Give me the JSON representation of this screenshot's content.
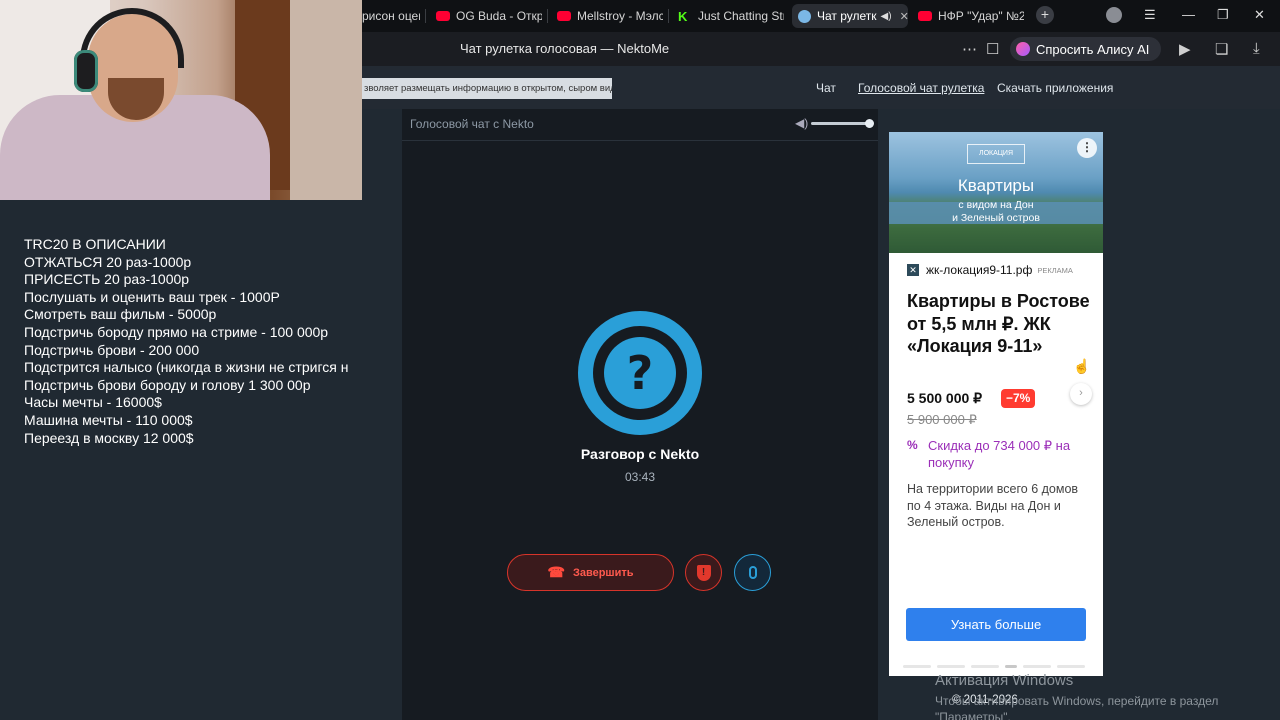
{
  "browser": {
    "tabs": [
      {
        "label": "рисон оцен",
        "icon": "none"
      },
      {
        "label": "OG Buda - Откр",
        "icon": "youtube"
      },
      {
        "label": "Mellstroy - Мэлс",
        "icon": "youtube"
      },
      {
        "label": "Just Chatting Str",
        "icon": "kick"
      },
      {
        "label": "Чат рулетк",
        "icon": "nekto",
        "active": true
      },
      {
        "label": "НФР \"Удар\" №2",
        "icon": "youtube"
      }
    ],
    "page_title": "Чат рулетка голосовая — NektoMe",
    "alice_button": "Спросить Алису AI",
    "close_tab_glyph": "✕",
    "new_tab_glyph": "+"
  },
  "site": {
    "notice": "зволяет размещать информацию в открытом, сыром виде!",
    "nav": [
      {
        "label": "Чат",
        "current": false
      },
      {
        "label": "Голосовой чат рулетка",
        "current": true
      },
      {
        "label": "Скачать приложения",
        "current": false
      }
    ],
    "chat_header": "Голосовой чат с Nekto",
    "volume_level": 1.0,
    "call": {
      "avatar_glyph": "?",
      "title": "Разговор с Nekto",
      "timer": "03:43",
      "end_button": "Завершить"
    },
    "copyright": "© 2011-2026"
  },
  "ad": {
    "image_logo": "ЛОКАЦИЯ",
    "image_headline": "Квартиры",
    "image_subline": "с видом на Дон\nи Зеленый остров",
    "domain": "жк-локация9-11.рф",
    "ad_label": "реклама",
    "title": "Квартиры в Ростове от 5,5 млн ₽. ЖК «Локация 9-11»",
    "price": "5 500 000 ₽",
    "discount": "−7%",
    "old_price": "5 900 000 ₽",
    "promo": "Скидка до 734 000 ₽ на покупку",
    "description": "На территории всего 6 домов по 4 этажа. Виды на Дон и Зеленый остров.",
    "cta": "Узнать больше",
    "carousel_current": 4,
    "carousel_total": 6
  },
  "overlay": {
    "donations": [
      "TRC20 В ОПИСАНИИ",
      "ОТЖАТЬСЯ 20 раз-1000р",
      "ПРИСЕСТЬ 20 раз-1000р",
      "Послушать и оценить ваш трек - 1000Р",
      "Смотреть ваш фильм - 5000р",
      "Подстричь бороду прямо на стриме - 100 000р",
      "Подстричь брови - 200 000",
      "Подстрится налысо (никогда в жизни не стригся н",
      "Подстричь брови бороду и голову 1 300 00р",
      "Часы мечты - 16000$",
      "Машина мечты - 110 000$",
      "Переезд в москву 12 000$"
    ]
  },
  "windows": {
    "activation_title": "Активация Windows",
    "activation_text": "Чтобы активировать Windows, перейдите в раздел",
    "activation_text2": "\"Параметры\"."
  },
  "colors": {
    "accent_blue": "#2a9fd8",
    "end_red": "#d6342a",
    "cta_blue": "#2f80ed",
    "promo_purple": "#9b2fb8"
  }
}
